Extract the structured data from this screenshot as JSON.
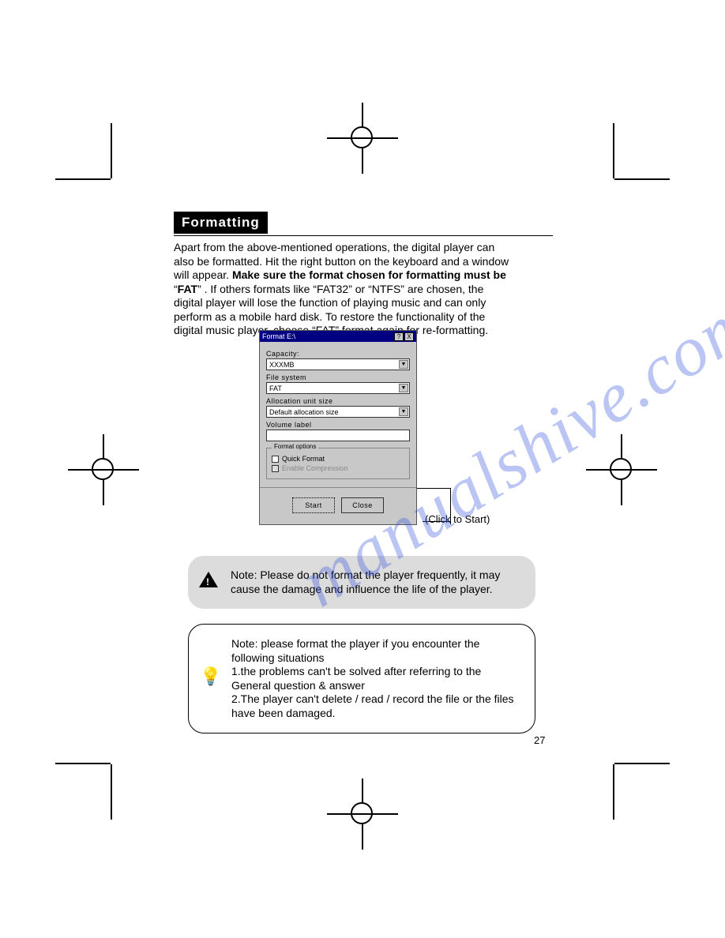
{
  "watermark": "manualshive.com",
  "section_title": "Formatting",
  "paragraph": {
    "line1": "Apart from the above-mentioned operations, the digital player can",
    "line2": "also be formatted. Hit the right button on the keyboard and a window",
    "line3a": "will appear. ",
    "line3b_bold": "Make sure the format chosen for formatting must be",
    "line4a": " “",
    "line4b_bold": "FAT",
    "line4c": "” . If others formats like “FAT32”  or “NTFS” are chosen, the",
    "line5": " digital player will lose the function of playing music and can only",
    "line6": "perform as a mobile hard disk. To restore the functionality of the",
    "line7": "digital music player, choose “FAT” format again for re-formatting."
  },
  "dialog": {
    "title": "Format E:\\",
    "help_btn": "?",
    "close_btn": "X",
    "capacity_label": "Capacity:",
    "capacity_value": "XXXMB",
    "fs_label": "File system",
    "fs_value": "FAT",
    "alloc_label": "Allocation unit size",
    "alloc_value": "Default allocation size",
    "vol_label": "Volume label",
    "vol_value": "",
    "options_legend": "Format options",
    "opt_quick": "Quick Format",
    "opt_compress": "Enable Compression",
    "start_btn": "Start",
    "close_btn2": "Close"
  },
  "callout": "(Click to Start)",
  "note1": "Note: Please do not format the player frequently, it may cause the damage and influence the life of the player.",
  "note2": {
    "l1": "Note: please format the player if you encounter the following situations",
    "l2": "1.the problems can't be solved after referring to the General question & answer",
    "l3": "2.The player can't delete / read / record the file or the files have been damaged."
  },
  "page_number": "27"
}
